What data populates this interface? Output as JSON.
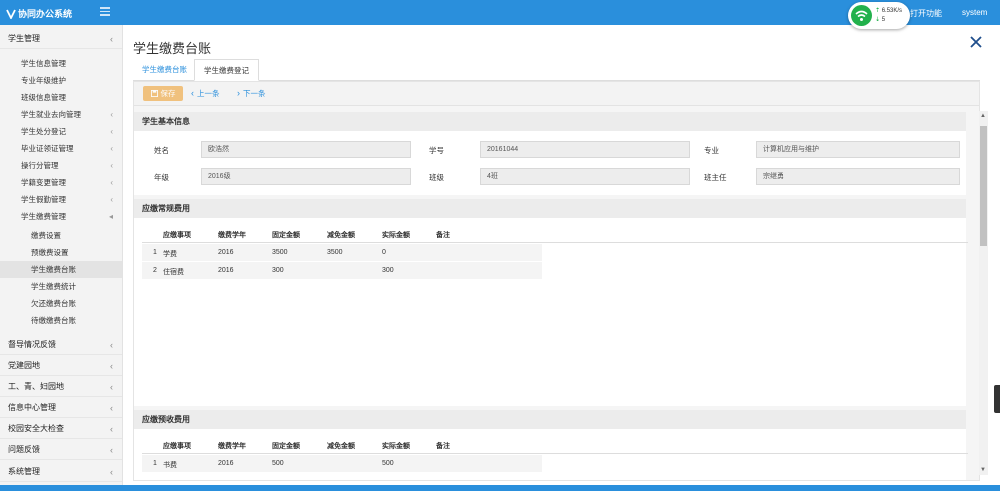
{
  "app": {
    "title": "协同办公系统",
    "open_func": "打开功能",
    "user": "system"
  },
  "network": {
    "upload": "6.53K/s",
    "download": "5"
  },
  "sidebar": {
    "sections": [
      {
        "label": "学生管理",
        "expanded": true
      },
      {
        "label": "督导情况反馈"
      },
      {
        "label": "党建园地"
      },
      {
        "label": "工、青、妇园地"
      },
      {
        "label": "信息中心管理"
      },
      {
        "label": "校园安全大检查"
      },
      {
        "label": "问题反馈"
      },
      {
        "label": "系统管理"
      }
    ],
    "student_items": [
      {
        "label": "学生信息管理",
        "has_children": false
      },
      {
        "label": "专业年级维护",
        "has_children": false
      },
      {
        "label": "班级信息管理",
        "has_children": false
      },
      {
        "label": "学生就业去向管理",
        "has_children": true
      },
      {
        "label": "学生处分登记",
        "has_children": true
      },
      {
        "label": "毕业证领证管理",
        "has_children": true
      },
      {
        "label": "操行分管理",
        "has_children": true
      },
      {
        "label": "学籍变更管理",
        "has_children": true
      },
      {
        "label": "学生假勤管理",
        "has_children": true
      },
      {
        "label": "学生缴费管理",
        "has_children": true,
        "expanded": true
      }
    ],
    "fee_items": [
      {
        "label": "缴费设置"
      },
      {
        "label": "预缴费设置"
      },
      {
        "label": "学生缴费台账",
        "active": true
      },
      {
        "label": "学生缴费统计"
      },
      {
        "label": "欠还缴费台账"
      },
      {
        "label": "待缴缴费台账"
      }
    ]
  },
  "page": {
    "title": "学生缴费台账",
    "tabs": [
      {
        "label": "学生缴费台账"
      },
      {
        "label": "学生缴费登记",
        "active": true
      }
    ]
  },
  "toolbar": {
    "save_label": "保存",
    "prev_label": "上一条",
    "next_label": "下一条"
  },
  "basic_info": {
    "header": "学生基本信息",
    "fields": {
      "name_label": "姓名",
      "name_value": "欧浩然",
      "id_label": "学号",
      "id_value": "20161044",
      "major_label": "专业",
      "major_value": "计算机应用与维护",
      "grade_label": "年级",
      "grade_value": "2016级",
      "class_label": "班级",
      "class_value": "4班",
      "teacher_label": "班主任",
      "teacher_value": "宗继勇"
    }
  },
  "regular_fees": {
    "header": "应缴常规费用",
    "columns": [
      "应缴事项",
      "缴费学年",
      "固定金额",
      "减免金额",
      "实际金额",
      "备注"
    ],
    "rows": [
      {
        "no": "1",
        "item": "学费",
        "year": "2016",
        "fixed": "3500",
        "waived": "3500",
        "actual": "0",
        "note": ""
      },
      {
        "no": "2",
        "item": "住宿费",
        "year": "2016",
        "fixed": "300",
        "waived": "",
        "actual": "300",
        "note": ""
      }
    ]
  },
  "prepaid_fees": {
    "header": "应缴预收费用",
    "columns": [
      "应缴事项",
      "缴费学年",
      "固定金额",
      "减免金额",
      "实际金额",
      "备注"
    ],
    "rows": [
      {
        "no": "1",
        "item": "书费",
        "year": "2016",
        "fixed": "500",
        "waived": "",
        "actual": "500",
        "note": ""
      }
    ]
  },
  "colors": {
    "primary": "#2a8fdc",
    "save": "#f0ad4e",
    "wifi": "#22b14c"
  }
}
